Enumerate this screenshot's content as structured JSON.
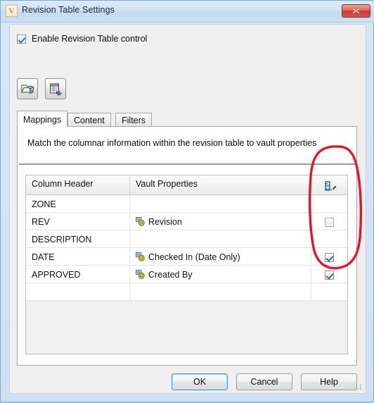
{
  "window": {
    "title": "Revision Table Settings",
    "logo_letter": "V",
    "close_icon": "close-icon"
  },
  "enable_control": {
    "label": "Enable Revision Table control",
    "checked": true
  },
  "toolbar": {
    "buttons": [
      {
        "name": "browse-vault-folder-button",
        "icon": "folder-key-icon"
      },
      {
        "name": "refresh-table-button",
        "icon": "table-refresh-icon"
      }
    ]
  },
  "tabs": [
    {
      "label": "Mappings",
      "active": true
    },
    {
      "label": "Content",
      "active": false
    },
    {
      "label": "Filters",
      "active": false
    }
  ],
  "mappings_tab": {
    "instruction": "Match the columnar information within the revision table to vault properties",
    "grid": {
      "headers": [
        "Column Header",
        "Vault Properties",
        ""
      ],
      "header_icon": "ruler-pen-icon",
      "rows": [
        {
          "column_header": "ZONE",
          "vault_property": "",
          "has_property_icon": false,
          "checkbox": "none"
        },
        {
          "column_header": "REV",
          "vault_property": "Revision",
          "has_property_icon": true,
          "checkbox": "unchecked"
        },
        {
          "column_header": "DESCRIPTION",
          "vault_property": "",
          "has_property_icon": false,
          "checkbox": "none"
        },
        {
          "column_header": "DATE",
          "vault_property": "Checked In (Date Only)",
          "has_property_icon": true,
          "checkbox": "checked"
        },
        {
          "column_header": "APPROVED",
          "vault_property": "Created By",
          "has_property_icon": true,
          "checkbox": "checked"
        },
        {
          "column_header": "",
          "vault_property": "",
          "has_property_icon": false,
          "checkbox": "none"
        }
      ]
    }
  },
  "footer_buttons": [
    {
      "label": "OK",
      "default": true
    },
    {
      "label": "Cancel",
      "default": false
    },
    {
      "label": "Help",
      "default": false
    }
  ],
  "annotation": {
    "type": "hand-drawn-ellipse",
    "color": "#e8142d",
    "target": "checkbox-column"
  },
  "colors": {
    "title_bar": "#cfe2f4",
    "dialog_background": "#efefef",
    "panel_background": "#ffffff",
    "accent_focus": "#3c99d4",
    "annotation_red": "#e8142d"
  }
}
